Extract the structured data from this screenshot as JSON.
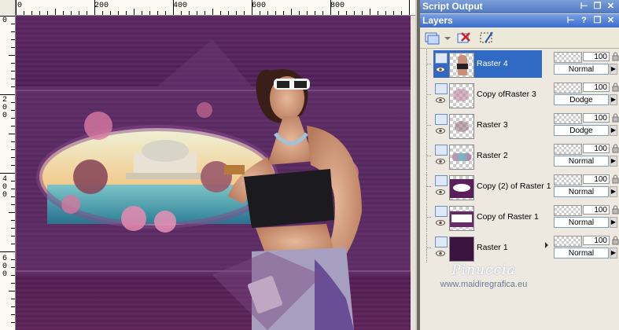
{
  "ruler": {
    "h_labels": [
      "0",
      "200",
      "400",
      "600",
      "800"
    ],
    "v_labels": [
      "0",
      "200",
      "400",
      "600"
    ]
  },
  "panels": {
    "script_output": {
      "title": "Script Output"
    },
    "layers": {
      "title": "Layers"
    }
  },
  "icons": {
    "panel_pin": "pin-icon",
    "panel_help": "help-icon",
    "panel_restore": "restore-icon",
    "panel_close": "close-icon",
    "new_layer": "new-raster-layer-icon",
    "delete_layer": "delete-layer-icon",
    "edit_mask": "edit-selection-icon"
  },
  "layers": [
    {
      "name": "Raster 4",
      "opacity": "100",
      "blend": "Normal",
      "selected": true
    },
    {
      "name": "Copy ofRaster 3",
      "opacity": "100",
      "blend": "Dodge",
      "selected": false
    },
    {
      "name": "Raster 3",
      "opacity": "100",
      "blend": "Dodge",
      "selected": false
    },
    {
      "name": "Raster 2",
      "opacity": "100",
      "blend": "Normal",
      "selected": false
    },
    {
      "name": "Copy (2) of Raster 1",
      "opacity": "100",
      "blend": "Normal",
      "selected": false
    },
    {
      "name": "Copy of Raster 1",
      "opacity": "100",
      "blend": "Normal",
      "selected": false
    },
    {
      "name": "Raster 1",
      "opacity": "100",
      "blend": "Normal",
      "selected": false
    }
  ],
  "watermark": {
    "name": "Pinuccia",
    "url": "www.maidiregrafica.eu"
  },
  "colors": {
    "accent": "#316ac5",
    "panel_title": "#3a6ccf",
    "image_purple": "#4a1a52",
    "image_pink": "#d06a9a"
  }
}
